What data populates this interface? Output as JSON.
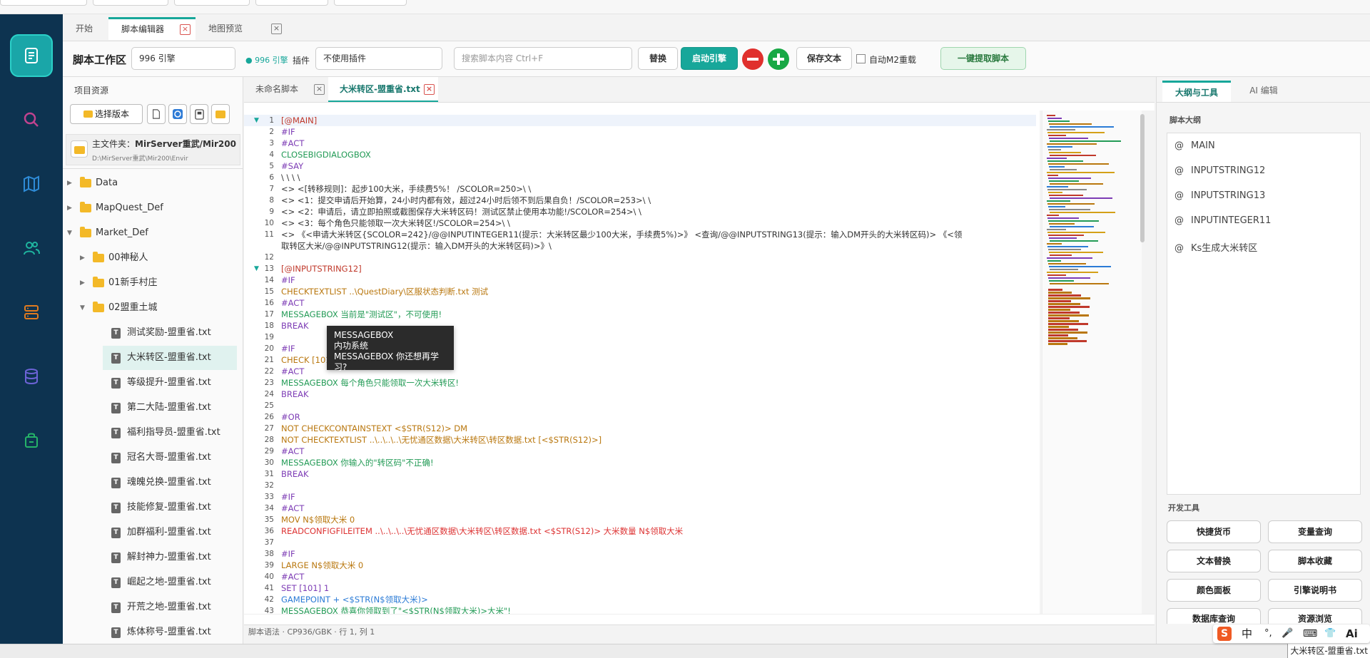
{
  "page_tabs": {
    "start": "开始",
    "script_editor": "脚本编辑器",
    "map_preview": "地图预览"
  },
  "toolbar": {
    "workspace_label": "脚本工作区",
    "engine_value": "996 引擎",
    "engine_badge": "● 996 引擎",
    "plugin_label": "插件",
    "plugin_value": "不使用插件",
    "search_placeholder": "搜索脚本内容  Ctrl+F",
    "replace_label": "替换",
    "start_engine_label": "启动引擎",
    "save_text_label": "保存文本",
    "auto_reload_label": "自动M2重载",
    "extract_label": "一键提取脚本"
  },
  "file_panel": {
    "title": "项目资源",
    "select_version_label": "选择版本",
    "main_folder_label": "主文件夹：",
    "main_folder_name": "MirServer重武/Mir200",
    "main_folder_path": "D:\\MirServer重武\\Mir200\\Envir",
    "tree": [
      {
        "label": "Data",
        "type": "folder",
        "level": 0,
        "caret": "▶"
      },
      {
        "label": "MapQuest_Def",
        "type": "folder",
        "level": 0,
        "caret": "▶"
      },
      {
        "label": "Market_Def",
        "type": "folder",
        "level": 0,
        "caret": "▼"
      },
      {
        "label": "00神秘人",
        "type": "folder",
        "level": 1,
        "caret": "▶"
      },
      {
        "label": "01新手村庄",
        "type": "folder",
        "level": 1,
        "caret": "▶"
      },
      {
        "label": "02盟重土城",
        "type": "folder",
        "level": 1,
        "caret": "▼"
      },
      {
        "label": "测试奖励-盟重省.txt",
        "type": "file",
        "level": 2
      },
      {
        "label": "大米转区-盟重省.txt",
        "type": "file",
        "level": 2,
        "selected": true
      },
      {
        "label": "等级提升-盟重省.txt",
        "type": "file",
        "level": 2
      },
      {
        "label": "第二大陆-盟重省.txt",
        "type": "file",
        "level": 2
      },
      {
        "label": "福利指导员-盟重省.txt",
        "type": "file",
        "level": 2
      },
      {
        "label": "冠名大哥-盟重省.txt",
        "type": "file",
        "level": 2
      },
      {
        "label": "魂魄兑换-盟重省.txt",
        "type": "file",
        "level": 2
      },
      {
        "label": "技能修复-盟重省.txt",
        "type": "file",
        "level": 2
      },
      {
        "label": "加群福利-盟重省.txt",
        "type": "file",
        "level": 2
      },
      {
        "label": "解封神力-盟重省.txt",
        "type": "file",
        "level": 2
      },
      {
        "label": "崛起之地-盟重省.txt",
        "type": "file",
        "level": 2
      },
      {
        "label": "开荒之地-盟重省.txt",
        "type": "file",
        "level": 2
      },
      {
        "label": "炼体称号-盟重省.txt",
        "type": "file",
        "level": 2
      }
    ]
  },
  "editor": {
    "tabs": [
      "未命名脚本",
      "大米转区-盟重省.txt"
    ],
    "lines": [
      {
        "n": "1",
        "fold": "▼",
        "c": "[@MAIN]",
        "k": "h"
      },
      {
        "n": "2",
        "c": "#IF",
        "k": "p"
      },
      {
        "n": "3",
        "c": "#ACT",
        "k": "p"
      },
      {
        "n": "4",
        "c": "CLOSEBIGDIALOGBOX",
        "k": "g"
      },
      {
        "n": "5",
        "c": "#SAY",
        "k": "p"
      },
      {
        "n": "6",
        "c": "\\ \\ \\ \\",
        "k": "d"
      },
      {
        "n": "7",
        "c": "<>   <[转移规则]：起步100大米，手续费5%！ /SCOLOR=250>\\ \\",
        "k": "d"
      },
      {
        "n": "8",
        "c": "<>   <1：提交申请后开始算，24小时内都有效，超过24小时后领不到后果自负！/SCOLOR=253>\\ \\",
        "k": "d"
      },
      {
        "n": "9",
        "c": "<>   <2：申请后，请立即拍照或截图保存大米转区码！测试区禁止使用本功能!/SCOLOR=254>\\ \\",
        "k": "d"
      },
      {
        "n": "10",
        "c": "<>   <3：每个角色只能领取一次大米转区!/SCOLOR=254>\\ \\",
        "k": "d"
      },
      {
        "n": "11",
        "c": "<>   《<申请大米转区{SCOLOR=242}/@@INPUTINTEGER11(提示：大米转区最少100大米，手续费5%)>》                 <查询/@@INPUTSTRING13(提示：输入DM开头的大米转区码)>                 《<领",
        "k": "d"
      },
      {
        "n": "",
        "c": "取转区大米/@@INPUTSTRING12(提示：输入DM开头的大米转区码)>》\\",
        "k": "d"
      },
      {
        "n": "12",
        "c": "",
        "k": "d"
      },
      {
        "n": "13",
        "fold": "▼",
        "c": "[@INPUTSTRING12]",
        "k": "h"
      },
      {
        "n": "14",
        "c": "#IF",
        "k": "p"
      },
      {
        "n": "15",
        "c": "CHECKTEXTLIST ..\\QuestDiary\\区服状态判断.txt 测试",
        "k": "o"
      },
      {
        "n": "16",
        "c": "#ACT",
        "k": "p"
      },
      {
        "n": "17",
        "c": "MESSAGEBOX 当前是\"测试区\"，不可使用!",
        "k": "g"
      },
      {
        "n": "18",
        "c": "BREAK",
        "k": "p"
      },
      {
        "n": "19",
        "c": "",
        "k": "d"
      },
      {
        "n": "20",
        "c": "#IF",
        "k": "p"
      },
      {
        "n": "21",
        "c": "CHECK [101] 1",
        "k": "o"
      },
      {
        "n": "22",
        "c": "#ACT",
        "k": "p"
      },
      {
        "n": "23",
        "c": "MESSAGEBOX 每个角色只能领取一次大米转区!",
        "k": "g"
      },
      {
        "n": "24",
        "c": "BREAK",
        "k": "p"
      },
      {
        "n": "25",
        "c": "",
        "k": "d"
      },
      {
        "n": "26",
        "c": "#OR",
        "k": "p"
      },
      {
        "n": "27",
        "c": "NOT CHECKCONTAINSTEXT <$STR(S12)> DM",
        "k": "o"
      },
      {
        "n": "28",
        "c": "NOT CHECKTEXTLIST ..\\..\\..\\..\\无忧通区数据\\大米转区\\转区数据.txt [<$STR(S12)>]",
        "k": "o"
      },
      {
        "n": "29",
        "c": "#ACT",
        "k": "p"
      },
      {
        "n": "30",
        "c": "MESSAGEBOX 你输入的\"转区码\"不正确!",
        "k": "g"
      },
      {
        "n": "31",
        "c": "BREAK",
        "k": "p"
      },
      {
        "n": "32",
        "c": "",
        "k": "d"
      },
      {
        "n": "33",
        "c": "#IF",
        "k": "p"
      },
      {
        "n": "34",
        "c": "#ACT",
        "k": "p"
      },
      {
        "n": "35",
        "c": "MOV N$领取大米 0",
        "k": "o"
      },
      {
        "n": "36",
        "c": "READCONFIGFILEITEM ..\\..\\..\\..\\无忧通区数据\\大米转区\\转区数据.txt <$STR(S12)> 大米数量 N$领取大米",
        "k": "r"
      },
      {
        "n": "37",
        "c": "",
        "k": "d"
      },
      {
        "n": "38",
        "c": "#IF",
        "k": "p"
      },
      {
        "n": "39",
        "c": "LARGE N$领取大米 0",
        "k": "o"
      },
      {
        "n": "40",
        "c": "#ACT",
        "k": "p"
      },
      {
        "n": "41",
        "c": "SET [101] 1",
        "k": "p"
      },
      {
        "n": "42",
        "c": "GAMEPOINT + <$STR(N$领取大米)>",
        "k": "b"
      },
      {
        "n": "43",
        "c": "MESSAGEBOX 恭喜你领取到了\"<$STR(N$领取大米)>大米\"!",
        "k": "g"
      }
    ],
    "tooltip": {
      "line1": "MESSAGEBOX",
      "line2": "内功系统",
      "line3": "MESSAGEBOX 你还想再学习?"
    },
    "status": "脚本语法  ·  CP936/GBK  ·  行 1, 列 1"
  },
  "right_panel": {
    "tabs": [
      "大纲与工具",
      "AI 编辑"
    ],
    "outline_title": "脚本大纲",
    "outline_items": [
      "MAIN",
      "INPUTSTRING12",
      "INPUTSTRING13",
      "INPUTINTEGER11",
      "Ks生成大米转区"
    ],
    "tools_title": "开发工具",
    "tools": [
      "快捷货币",
      "变量查询",
      "文本替换",
      "脚本收藏",
      "颜色面板",
      "引擎说明书",
      "数据库查询",
      "资源浏览"
    ]
  },
  "ime": {
    "items": [
      "S",
      "中",
      "°,",
      "🎤",
      "⌨",
      "👕",
      "Ai"
    ]
  },
  "taskbar_file": "大米转区-盟重省.txt",
  "colors": {
    "accent": "#17a79a",
    "rail": "#0d3350",
    "rail_icon": "#1aa6a8"
  }
}
